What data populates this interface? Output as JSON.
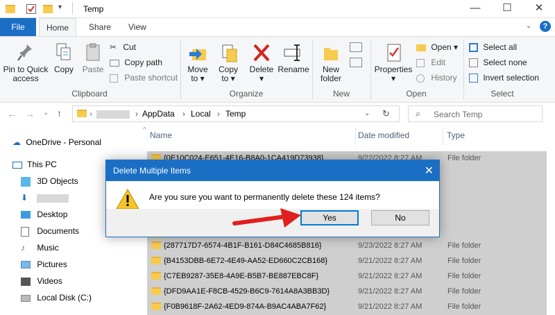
{
  "window": {
    "title": "Temp",
    "minimize": "—",
    "maximize": "☐",
    "close": "✕"
  },
  "tabs": [
    {
      "label": "File"
    },
    {
      "label": "Home"
    },
    {
      "label": "Share"
    },
    {
      "label": "View"
    }
  ],
  "ribbon": {
    "clipboard": {
      "pin_label_1": "Pin to Quick",
      "pin_label_2": "access",
      "copy": "Copy",
      "paste": "Paste",
      "cut": "Cut",
      "copy_path": "Copy path",
      "paste_shortcut": "Paste shortcut",
      "group": "Clipboard"
    },
    "organize": {
      "move_to_1": "Move",
      "move_to_2": "to ▾",
      "copy_to_1": "Copy",
      "copy_to_2": "to ▾",
      "delete_1": "Delete",
      "delete_2": "▾",
      "rename": "Rename",
      "group": "Organize"
    },
    "new": {
      "new_folder_1": "New",
      "new_folder_2": "folder",
      "group": "New"
    },
    "open": {
      "properties_1": "Properties",
      "properties_2": "▾",
      "open": "Open ▾",
      "edit": "Edit",
      "history": "History",
      "group": "Open"
    },
    "select": {
      "select_all": "Select all",
      "select_none": "Select none",
      "invert": "Invert selection",
      "group": "Select"
    }
  },
  "address": {
    "crumbs": [
      "›",
      "AppData",
      "›",
      "Local",
      "›",
      "Temp"
    ],
    "search_placeholder": "Search Temp"
  },
  "nav": [
    {
      "label": "OneDrive - Personal"
    },
    {
      "label": "This PC"
    },
    {
      "label": "3D Objects"
    },
    {
      "label": ""
    },
    {
      "label": "Desktop"
    },
    {
      "label": "Documents"
    },
    {
      "label": "Music"
    },
    {
      "label": "Pictures"
    },
    {
      "label": "Videos"
    },
    {
      "label": "Local Disk (C:)"
    }
  ],
  "columns": {
    "name": "Name",
    "date": "Date modified",
    "type": "Type"
  },
  "rows": [
    {
      "name": "{0E10C024-E651-4E16-B8A0-1CA419D73938}",
      "date": "9/22/2022 8:27 AM",
      "type": "File folder"
    },
    {
      "name": "{287717D7-6574-4B1F-B161-D84C4685B816}",
      "date": "9/23/2022 8:27 AM",
      "type": "File folder"
    },
    {
      "name": "{B4153DBB-6E72-4E49-AA52-ED660C2CB168}",
      "date": "9/21/2022 8:27 AM",
      "type": "File folder"
    },
    {
      "name": "{C7EB9287-35E8-4A9E-B5B7-BE887EBC8F}",
      "date": "9/21/2022 8:27 AM",
      "type": "File folder"
    },
    {
      "name": "{DFD9AA1E-F8CB-4529-B6C9-7614A8A3BB3D}",
      "date": "9/21/2022 8:27 AM",
      "type": "File folder"
    },
    {
      "name": "{F0B9618F-2A62-4ED9-874A-B9AC4ABA7F62}",
      "date": "9/21/2022 8:27 AM",
      "type": "File folder"
    }
  ],
  "dialog": {
    "title": "Delete Multiple Items",
    "message": "Are you sure you want to permanently delete these 124 items?",
    "yes": "Yes",
    "no": "No"
  },
  "colors": {
    "accent": "#1a6fc4",
    "selection": "#cfcfcf",
    "arrow": "#e0201e"
  }
}
